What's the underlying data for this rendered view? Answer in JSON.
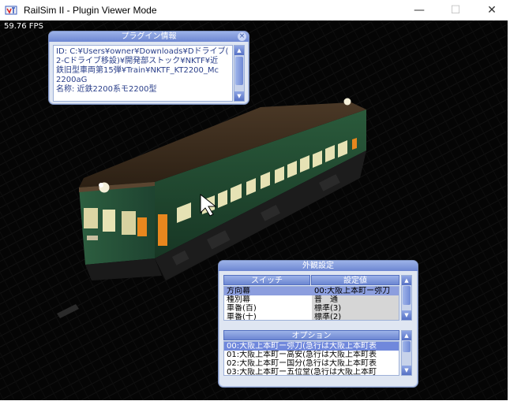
{
  "window": {
    "title": "RailSim II - Plugin Viewer Mode",
    "minimize_glyph": "—",
    "maximize_glyph": "☐",
    "close_glyph": "✕"
  },
  "viewport": {
    "fps": "59.76 FPS",
    "background": "#060606"
  },
  "plugin_info": {
    "title": "プラグイン情報",
    "close_glyph": "×",
    "lines": [
      "ID: C:¥Users¥owner¥Downloads¥Dドライブ(",
      "2-Cドライブ移設)¥開発部ストック¥NKTF¥近",
      "鉄旧型車両第15弾¥Train¥NKTF_KT2200_Mc",
      "2200aG",
      "名称: 近鉄2200系モ2200型"
    ]
  },
  "appearance": {
    "title": "外観設定",
    "switch_header": "スイッチ",
    "value_header": "設定値",
    "switches": [
      {
        "name": "方向幕",
        "value": "00:大阪上本町ー弥刀"
      },
      {
        "name": "種別幕",
        "value": "普　通"
      },
      {
        "name": "車番(百)",
        "value": "標準(3)"
      },
      {
        "name": "車番(十)",
        "value": "標準(2)"
      }
    ],
    "options_header": "オプション",
    "options": [
      "00:大阪上本町ー弥刀(急行は大阪上本町表",
      "01:大阪上本町ー高安(急行は大阪上本町表",
      "02:大阪上本町ー国分(急行は大阪上本町表",
      "03:大阪上本町ー五位堂(急行は大阪上本町"
    ]
  },
  "colors": {
    "train_body": "#1c3f2a",
    "train_roof": "#3b2a1a",
    "window_glow": "#f2f0c8",
    "door_orange": "#e8871e",
    "panel_bg": "#dfe6f2",
    "panel_accent": "#6c86d2"
  }
}
